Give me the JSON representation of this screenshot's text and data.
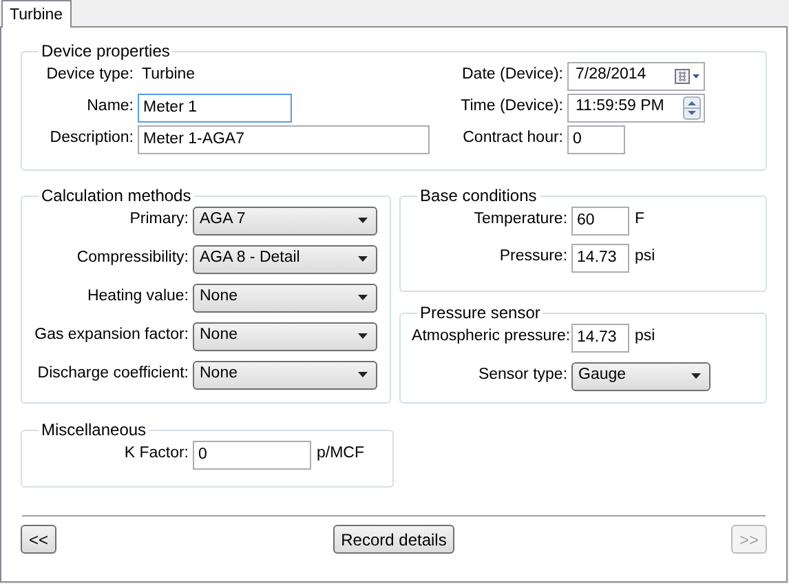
{
  "tab": {
    "label": "Turbine",
    "selected": true
  },
  "device_properties": {
    "title": "Device properties",
    "left": [
      {
        "kind": "static",
        "label": "Device type:",
        "value": "Turbine"
      },
      {
        "kind": "text",
        "label": "Name:",
        "value": "Meter 1",
        "focused": true
      },
      {
        "kind": "text",
        "label": "Description:",
        "value": "Meter 1-AGA7",
        "focused": false
      }
    ],
    "right": [
      {
        "kind": "date",
        "label": "Date (Device):",
        "value": "7/28/2014"
      },
      {
        "kind": "time",
        "label": "Time (Device):",
        "value": "11:59:59 PM"
      },
      {
        "kind": "text",
        "label": "Contract hour:",
        "value": "0",
        "focused": false
      }
    ]
  },
  "calculation_methods": {
    "title": "Calculation methods",
    "fields": [
      {
        "kind": "select",
        "label": "Primary:",
        "value": "AGA 7"
      },
      {
        "kind": "select",
        "label": "Compressibility:",
        "value": "AGA 8 - Detail"
      },
      {
        "kind": "select",
        "label": "Heating value:",
        "value": "None"
      },
      {
        "kind": "select",
        "label": "Gas expansion factor:",
        "value": "None"
      },
      {
        "kind": "select",
        "label": "Discharge coefficient:",
        "value": "None"
      }
    ]
  },
  "base_conditions": {
    "title": "Base conditions",
    "fields": [
      {
        "kind": "text",
        "label": "Temperature:",
        "value": "60",
        "unit": "F",
        "focused": false
      },
      {
        "kind": "text",
        "label": "Pressure:",
        "value": "14.73",
        "unit": "psi",
        "focused": false
      }
    ]
  },
  "pressure_sensor": {
    "title": "Pressure sensor",
    "fields": [
      {
        "kind": "text",
        "label": "Atmospheric pressure:",
        "value": "14.73",
        "unit": "psi",
        "focused": false
      },
      {
        "kind": "select",
        "label": "Sensor type:",
        "value": "Gauge"
      }
    ]
  },
  "miscellaneous": {
    "title": "Miscellaneous",
    "fields": [
      {
        "kind": "text",
        "label": "K Factor:",
        "value": "0",
        "unit": "p/MCF",
        "focused": false
      }
    ]
  },
  "buttons": [
    {
      "label": "<<",
      "disabled": false
    },
    {
      "label": "Record details",
      "disabled": false
    },
    {
      "label": ">>",
      "disabled": true
    }
  ]
}
